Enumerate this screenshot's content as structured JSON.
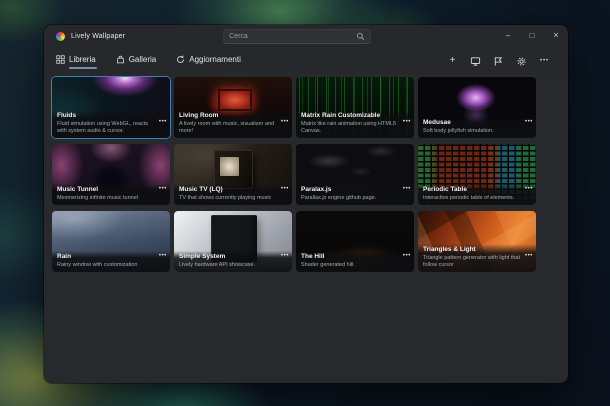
{
  "app": {
    "name": "Lively Wallpaper"
  },
  "titlebar": {
    "search_placeholder": "Cerca",
    "controls": {
      "minimize": "–",
      "maximize": "□",
      "close": "×"
    }
  },
  "nav": {
    "selected": "Libreria",
    "tabs": [
      {
        "label": "Libreria"
      },
      {
        "label": "Galleria"
      },
      {
        "label": "Aggiornamenti"
      }
    ]
  },
  "toolbar": {
    "add_glyph": "+",
    "more_glyph": "•••"
  },
  "glyphs": {
    "card_menu": "•••"
  },
  "icons": {
    "logo": "lively-color-wheel",
    "search": "magnifier",
    "library_tab": "grid",
    "gallery_tab": "shopping-bag",
    "updates_tab": "sync-arrow",
    "add": "plus",
    "screens": "monitor",
    "report": "flag",
    "settings": "gear",
    "more": "ellipsis",
    "card_menu": "ellipsis"
  },
  "colors": {
    "accent": "#6c96b0",
    "window_bg": "#26282c",
    "content_bg": "#28292d",
    "active_card_border": "#3f7fb5"
  },
  "cards": [
    {
      "title": "Fluids",
      "description": "Fluid simulation using WebGL, reacts with system audio & cursor.",
      "active": true
    },
    {
      "title": "Living Room",
      "description": "A lively room with music, visualizer and more!",
      "active": false
    },
    {
      "title": "Matrix Rain Customizable",
      "description": "Matrix like rain animation using HTML5 Canvas.",
      "active": false
    },
    {
      "title": "Medusae",
      "description": "Soft body jellyfish simulation.",
      "active": false
    },
    {
      "title": "Music Tunnel",
      "description": "Mesmerizing infinite music tunnel",
      "active": false
    },
    {
      "title": "Music TV (LQ)",
      "description": "TV that shows currently playing music",
      "active": false
    },
    {
      "title": "Paralax.js",
      "description": "Parallax.js engine github page.",
      "active": false
    },
    {
      "title": "Periodic Table",
      "description": "Interactive periodic table of elements.",
      "active": false
    },
    {
      "title": "Rain",
      "description": "Rainy window with customization",
      "active": false
    },
    {
      "title": "Simple System",
      "description": "Lively hardware API showcase.",
      "active": false
    },
    {
      "title": "The Hill",
      "description": "Shader generated hill.",
      "active": false
    },
    {
      "title": "Triangles & Light",
      "description": "Triangle pattern generator with light that follow cursor",
      "active": false
    }
  ]
}
